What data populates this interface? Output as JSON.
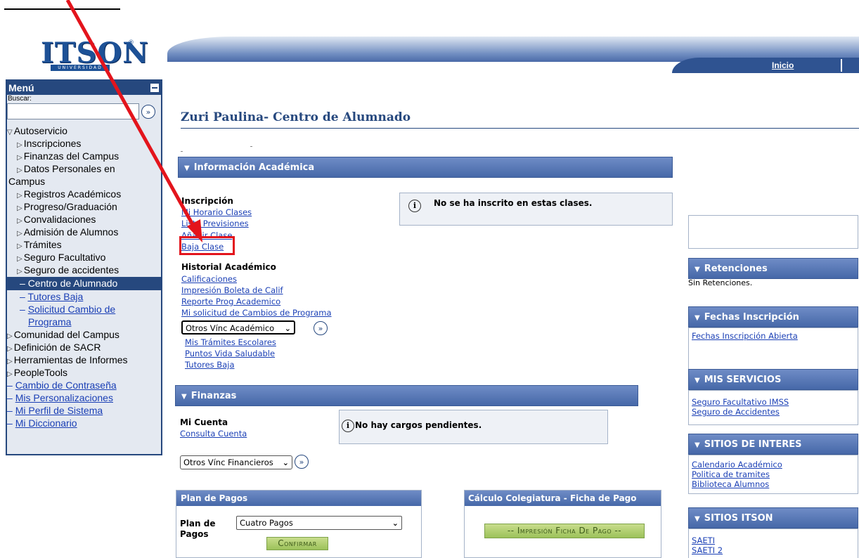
{
  "logo": {
    "text": "ITSON",
    "sub": "UNIVERSIDAD",
    "reg": "®"
  },
  "header": {
    "nav_inicio": "Inicio"
  },
  "menu": {
    "title": "Menú",
    "search_label": "Buscar:",
    "go": "»",
    "items": [
      {
        "label": "Autoservicio",
        "marker": "▽"
      },
      {
        "label": "Inscripciones",
        "marker": "▷"
      },
      {
        "label": "Finanzas del Campus",
        "marker": "▷"
      },
      {
        "label": "Datos Personales en",
        "marker": "▷"
      },
      {
        "label": "Campus"
      },
      {
        "label": "Registros Académicos",
        "marker": "▷"
      },
      {
        "label": "Progreso/Graduación",
        "marker": "▷"
      },
      {
        "label": "Convalidaciones",
        "marker": "▷"
      },
      {
        "label": "Admisión de Alumnos",
        "marker": "▷"
      },
      {
        "label": "Trámites",
        "marker": "▷"
      },
      {
        "label": "Seguro Facultativo",
        "marker": "▷"
      },
      {
        "label": "Seguro de accidentes",
        "marker": "▷"
      },
      {
        "label": "Centro de Alumnado",
        "marker": "–"
      },
      {
        "label": "Tutores Baja",
        "marker": "–"
      },
      {
        "label": "Solicitud Cambio de",
        "marker": "–"
      },
      {
        "label": "Programa"
      },
      {
        "label": "Comunidad del Campus",
        "marker": "▷"
      },
      {
        "label": "Definición de SACR",
        "marker": "▷"
      },
      {
        "label": "Herramientas de Informes",
        "marker": "▷"
      },
      {
        "label": "PeopleTools",
        "marker": "▷"
      },
      {
        "label": "Cambio de Contraseña",
        "marker": "–"
      },
      {
        "label": "Mis Personalizaciones",
        "marker": "–"
      },
      {
        "label": "Mi Perfil de Sistema",
        "marker": "–"
      },
      {
        "label": "Mi Diccionario",
        "marker": "–"
      }
    ]
  },
  "page": {
    "title": "Zuri Paulina- Centro de Alumnado"
  },
  "academic": {
    "header": "Información Académica",
    "inscripcion_label": "Inscripción",
    "inscripcion_links": [
      "Mi Horario Clases",
      "Lista Previsiones",
      "Añadir Clase",
      "Baja Clase"
    ],
    "info_text": "No se ha inscrito en estas clases.",
    "historial_label": "Historial Académico",
    "historial_links": [
      "Calificaciones",
      "Impresión Boleta de Calif",
      "Reporte Prog Academico",
      "Mi solicitud de Cambios de Programa"
    ],
    "select_value": "Otros Vínc Académico",
    "extra_links": [
      "Mis Trámites Escolares",
      "Puntos Vida Saludable",
      "Tutores Baja"
    ]
  },
  "finanzas": {
    "header": "Finanzas",
    "cuenta_label": "Mi Cuenta",
    "cuenta_link": "Consulta Cuenta",
    "info_text": "No hay cargos pendientes.",
    "select_value": "Otros Vínc Financieros"
  },
  "plan_pagos": {
    "header": "Plan de Pagos",
    "field_label": "Plan de Pagos",
    "select_value": "Cuatro Pagos",
    "confirm": "Confirmar"
  },
  "calculo": {
    "header": "Cálculo Colegiatura - Ficha de Pago",
    "button": "-- Impresión Ficha De Pago --"
  },
  "right": {
    "retenciones": {
      "header": "Retenciones",
      "text": "Sin Retenciones."
    },
    "fechas": {
      "header": "Fechas Inscripción",
      "links": [
        "Fechas Inscripción Abierta"
      ]
    },
    "servicios": {
      "header": "MIS SERVICIOS",
      "links": [
        "Seguro Facultativo IMSS",
        "Seguro de Accidentes"
      ]
    },
    "interes": {
      "header": "SITIOS DE INTERES",
      "links": [
        "Calendario Académico",
        "Politica de tramites",
        "Biblioteca Alumnos"
      ]
    },
    "itson": {
      "header": "SITIOS ITSON",
      "links": [
        "SAETI",
        "SAETI 2"
      ]
    }
  },
  "colors": {
    "menu_blue": "#26487e",
    "link": "#1a3fb5",
    "annotation_red": "#e3141c"
  }
}
